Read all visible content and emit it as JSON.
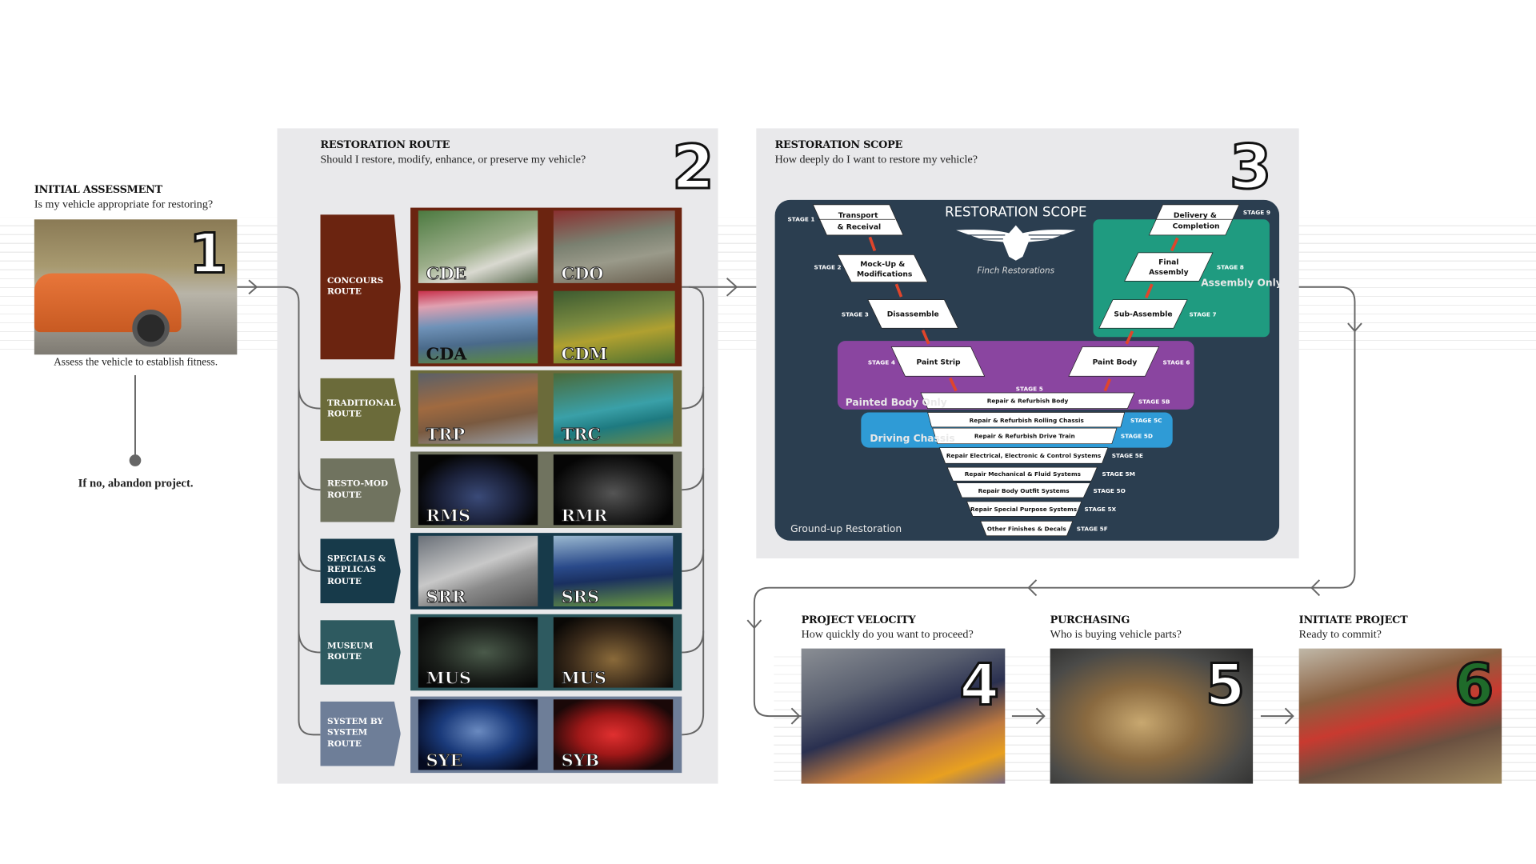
{
  "step1": {
    "title": "INITIAL ASSESSMENT",
    "question": "Is my vehicle appropriate for restoring?",
    "number": "1",
    "caption": "Assess the vehicle to establish fitness.",
    "abandon": "If no, abandon project."
  },
  "step2": {
    "title": "RESTORATION ROUTE",
    "question": "Should I restore, modify, enhance, or preserve my vehicle?",
    "number": "2",
    "routes": [
      {
        "label": "CONCOURS ROUTE",
        "color": "#6b2410",
        "codes": [
          "CDE",
          "CDO",
          "CDA",
          "CDM"
        ]
      },
      {
        "label": "TRADITIONAL ROUTE",
        "color": "#6b6b3a",
        "codes": [
          "TRP",
          "TRC"
        ]
      },
      {
        "label": "RESTO-MOD ROUTE",
        "color": "#70735f",
        "codes": [
          "RMS",
          "RMR"
        ]
      },
      {
        "label": "SPECIALS & REPLICAS ROUTE",
        "color": "#173a4a",
        "codes": [
          "SRR",
          "SRS"
        ]
      },
      {
        "label": "MUSEUM ROUTE",
        "color": "#2e5a60",
        "codes": [
          "MUS",
          "MUS"
        ]
      },
      {
        "label": "SYSTEM BY SYSTEM ROUTE",
        "color": "#6e7e98",
        "codes": [
          "SYE",
          "SYB"
        ]
      }
    ]
  },
  "step3": {
    "title": "RESTORATION SCOPE",
    "question": "How deeply do I want to restore my vehicle?",
    "number": "3",
    "diagram": {
      "title": "RESTORATION SCOPE",
      "logo_text": "Finch Restorations",
      "stages": [
        {
          "label": "STAGE 1",
          "name_1": "Transport",
          "name_2": "& Receival"
        },
        {
          "label": "STAGE 2",
          "name_1": "Mock-Up &",
          "name_2": "Modifications"
        },
        {
          "label": "STAGE 3",
          "name": "Disassemble"
        },
        {
          "label": "STAGE 4",
          "name": "Paint Strip"
        },
        {
          "label": "STAGE 5"
        },
        {
          "label": "STAGE 6",
          "name": "Paint Body"
        },
        {
          "label": "STAGE 7",
          "name": "Sub-Assemble"
        },
        {
          "label": "STAGE 8",
          "name_1": "Final",
          "name_2": "Assembly"
        },
        {
          "label": "STAGE 9",
          "name_1": "Delivery &",
          "name_2": "Completion"
        }
      ],
      "substages": [
        {
          "label": "STAGE 5B",
          "name": "Repair & Refurbish Body"
        },
        {
          "label": "STAGE 5C",
          "name": "Repair & Refurbish Rolling Chassis"
        },
        {
          "label": "STAGE 5D",
          "name": "Repair & Refurbish Drive Train"
        },
        {
          "label": "STAGE 5E",
          "name": "Repair Electrical, Electronic & Control Systems"
        },
        {
          "label": "STAGE 5M",
          "name": "Repair Mechanical & Fluid Systems"
        },
        {
          "label": "STAGE 5O",
          "name": "Repair Body Outfit Systems"
        },
        {
          "label": "STAGE 5X",
          "name": "Repair Special Purpose Systems"
        },
        {
          "label": "STAGE 5F",
          "name": "Other Finishes & Decals"
        }
      ],
      "zones": {
        "assembly": "Assembly Only",
        "painted": "Painted Body Only",
        "chassis": "Driving Chassis",
        "groundup": "Ground-up Restoration"
      },
      "colors": {
        "background": "#2b3e50",
        "assembly": "#1f9b80",
        "painted": "#8a45a0",
        "chassis": "#2f9bd6",
        "arrow": "#e0452b"
      }
    }
  },
  "step4": {
    "title": "PROJECT VELOCITY",
    "question": "How quickly do you want to proceed?",
    "number": "4"
  },
  "step5": {
    "title": "PURCHASING",
    "question": "Who is buying vehicle parts?",
    "number": "5"
  },
  "step6": {
    "title": "INITIATE PROJECT",
    "question": "Ready to commit?",
    "number": "6",
    "number_color": "#1f6b2a"
  }
}
